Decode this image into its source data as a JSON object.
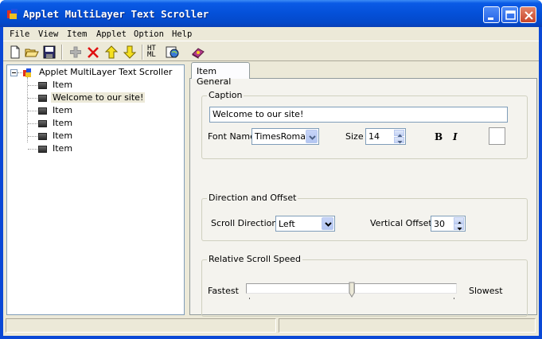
{
  "window": {
    "title": "Applet MultiLayer Text Scroller"
  },
  "menu": {
    "items": [
      "File",
      "View",
      "Item",
      "Applet",
      "Option",
      "Help"
    ]
  },
  "toolbar": {
    "buttons": [
      "new-icon",
      "open-icon",
      "save-icon",
      "add-icon",
      "delete-icon",
      "move-up-icon",
      "move-down-icon",
      "html-icon",
      "preview-icon",
      "help-book-icon"
    ],
    "html_label_top": "HT",
    "html_label_bottom": "ML"
  },
  "tree": {
    "root": "Applet MultiLayer Text Scroller",
    "items": [
      "Item",
      "Welcome to our site!",
      "Item",
      "Item",
      "Item",
      "Item"
    ],
    "selected_index": 1
  },
  "tabs": [
    "Item General"
  ],
  "caption_group": {
    "title": "Caption",
    "text": "Welcome to our site!",
    "font_name_label": "Font Name",
    "font_name_value": "TimesRoman",
    "size_label": "Size",
    "size_value": "14",
    "bold_label": "B",
    "italic_label": "I"
  },
  "direction_group": {
    "title": "Direction and Offset",
    "scroll_direction_label": "Scroll Direction",
    "scroll_direction_value": "Left",
    "vertical_offset_label": "Vertical Offset",
    "vertical_offset_value": "30"
  },
  "speed_group": {
    "title": "Relative Scroll Speed",
    "fastest_label": "Fastest",
    "slowest_label": "Slowest",
    "speed_fraction": 0.5
  },
  "colors": {
    "titlebar": "#0450d8",
    "face": "#ece9d8",
    "panel": "#f4f3ee"
  }
}
